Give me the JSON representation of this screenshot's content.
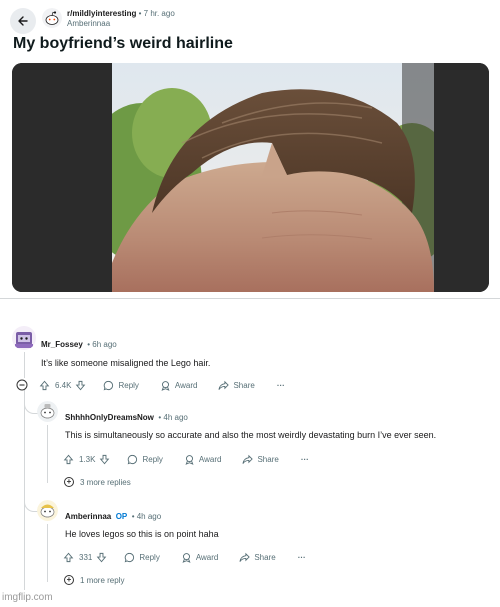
{
  "post": {
    "subreddit": "r/mildlyinteresting",
    "separator": "•",
    "time": "7 hr. ago",
    "author": "Amberinnaa",
    "title": "My boyfriend’s weird hairline"
  },
  "comments": [
    {
      "user": "Mr_Fossey",
      "time": "6h ago",
      "body": "It’s like someone misaligned the Lego hair.",
      "votes": "6.4K",
      "reply_label": "Reply",
      "award_label": "Award",
      "share_label": "Share",
      "more_label": "···"
    },
    {
      "user": "ShhhhOnlyDreamsNow",
      "time": "4h ago",
      "body": "This is simultaneously so accurate and also the most weirdly devastating burn I’ve ever seen.",
      "votes": "1.3K",
      "reply_label": "Reply",
      "award_label": "Award",
      "share_label": "Share",
      "more_label": "···",
      "more_replies": "3 more replies"
    },
    {
      "user": "Amberinnaa",
      "op_badge": "OP",
      "time": "4h ago",
      "body": "He loves legos so this is on point haha",
      "votes": "331",
      "reply_label": "Reply",
      "award_label": "Award",
      "share_label": "Share",
      "more_label": "···",
      "more_replies": "1 more reply"
    }
  ],
  "watermark": "imgflip.com",
  "icons": [
    "arrow-left-icon",
    "upvote-icon",
    "downvote-icon",
    "reply-bubble-icon",
    "award-icon",
    "share-icon",
    "collapse-icon",
    "expand-plus-icon"
  ],
  "colors": {
    "accent_link": "#0079d3",
    "meta_text": "#576f76",
    "divider": "#d4d7d9"
  }
}
